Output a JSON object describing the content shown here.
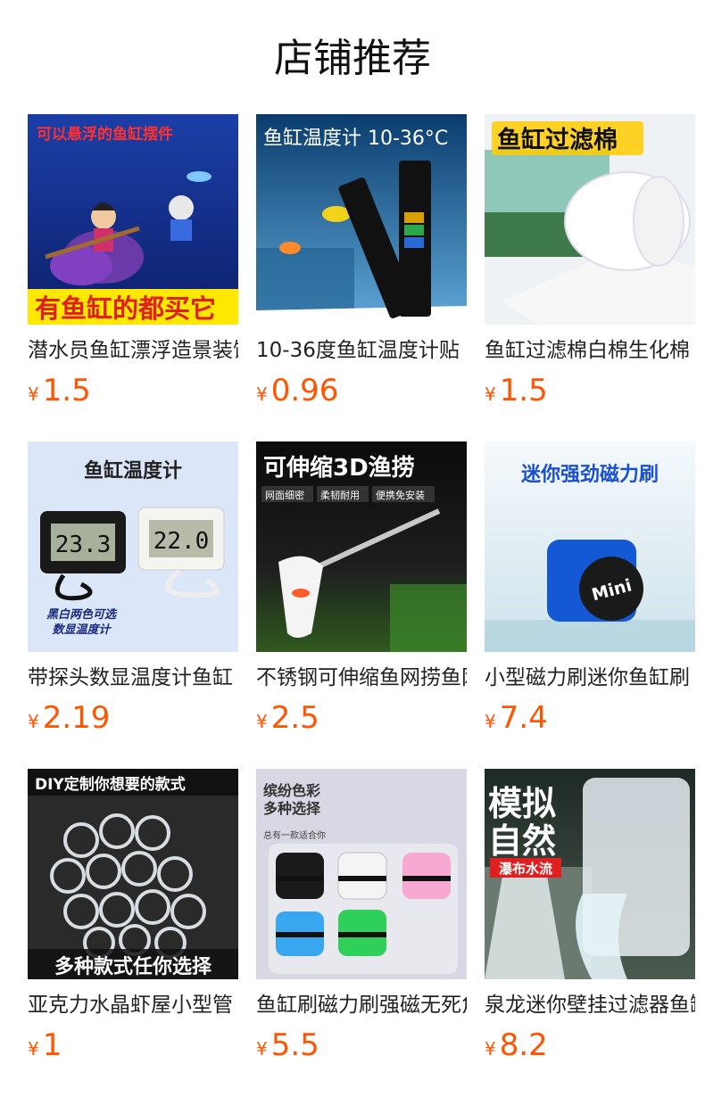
{
  "page": {
    "title": "店铺推荐"
  },
  "currency_symbol": "¥",
  "products": [
    {
      "name": "潜水员鱼缸漂浮造景装饰",
      "price": "1.5",
      "image_text": [
        "可以悬浮的鱼缸摆件",
        "有鱼缸的都买它"
      ]
    },
    {
      "name": "10-36度鱼缸温度计贴",
      "price": "0.96",
      "image_text": [
        "鱼缸温度计 10-36°C"
      ]
    },
    {
      "name": "鱼缸过滤棉白棉生化棉",
      "price": "1.5",
      "image_text": [
        "鱼缸过滤棉"
      ]
    },
    {
      "name": "带探头数显温度计鱼缸",
      "price": "2.19",
      "image_text": [
        "鱼缸温度计",
        "23.3",
        "22.0",
        "黑白两色可选",
        "数显温度计"
      ]
    },
    {
      "name": "不锈钢可伸缩鱼网捞鱼网",
      "price": "2.5",
      "image_text": [
        "可伸缩3D渔捞",
        "网面细密",
        "柔韧耐用",
        "便携免安装"
      ]
    },
    {
      "name": "小型磁力刷迷你鱼缸刷",
      "price": "7.4",
      "image_text": [
        "迷你强劲磁力刷",
        "Mini"
      ]
    },
    {
      "name": "亚克力水晶虾屋小型管",
      "price": "1",
      "image_text": [
        "DIY定制你想要的款式",
        "多种款式任你选择"
      ]
    },
    {
      "name": "鱼缸刷磁力刷强磁无死角",
      "price": "5.5",
      "image_text": [
        "缤纷色彩",
        "多种选择",
        "总有一款适合你"
      ]
    },
    {
      "name": "泉龙迷你壁挂过滤器鱼缸",
      "price": "8.2",
      "image_text": [
        "模拟",
        "自然",
        "瀑布水流"
      ]
    }
  ]
}
